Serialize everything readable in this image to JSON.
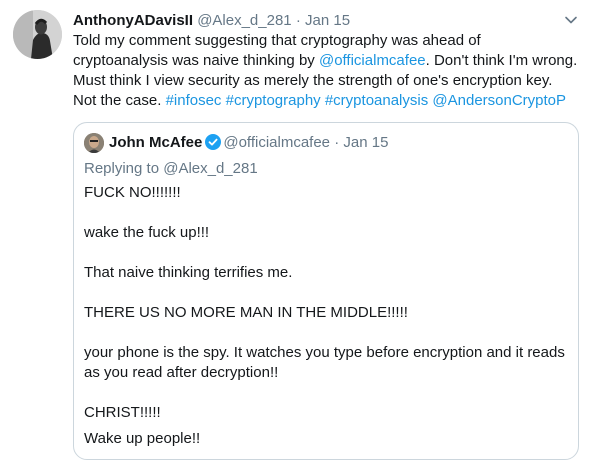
{
  "tweet": {
    "author_name": "AnthonyADavisII",
    "handle": "@Alex_d_281",
    "separator": " · ",
    "date": "Jan 15",
    "text_1": "Told my comment suggesting that cryptography was ahead of cryptoanalysis was naive thinking by ",
    "mention_mcafee": "@officialmcafee",
    "text_2": ". Don't think I'm wrong. Must think I view security as merely the strength of one's encryption key. Not the case. ",
    "hashtag_infosec": "#infosec",
    "hashtag_cryptography": "#cryptography",
    "hashtag_cryptoanalysis": "#cryptoanalysis",
    "mention_anderson": "@AndersonCryptoP",
    "more_icon": "chevron-down-icon"
  },
  "quoted": {
    "author_name": "John McAfee",
    "verified_icon": "verified-badge-icon",
    "handle": "@officialmcafee",
    "separator": " · ",
    "date": "Jan 15",
    "replying_prefix": "Replying to ",
    "replying_handle": "@Alex_d_281",
    "lines": [
      "FUCK NO!!!!!!!",
      "wake the fuck up!!!",
      "That naive thinking terrifies me.",
      "THERE US NO MORE MAN IN THE MIDDLE!!!!!",
      "your phone is the spy. It watches you type before encryption and it reads as you read after decryption!!",
      "CHRIST!!!!!",
      "Wake up people!!"
    ]
  },
  "colors": {
    "text": "#14171a",
    "secondary": "#657786",
    "link": "#1b95e0",
    "border": "#ccd6dd",
    "verified": "#1da1f2"
  }
}
